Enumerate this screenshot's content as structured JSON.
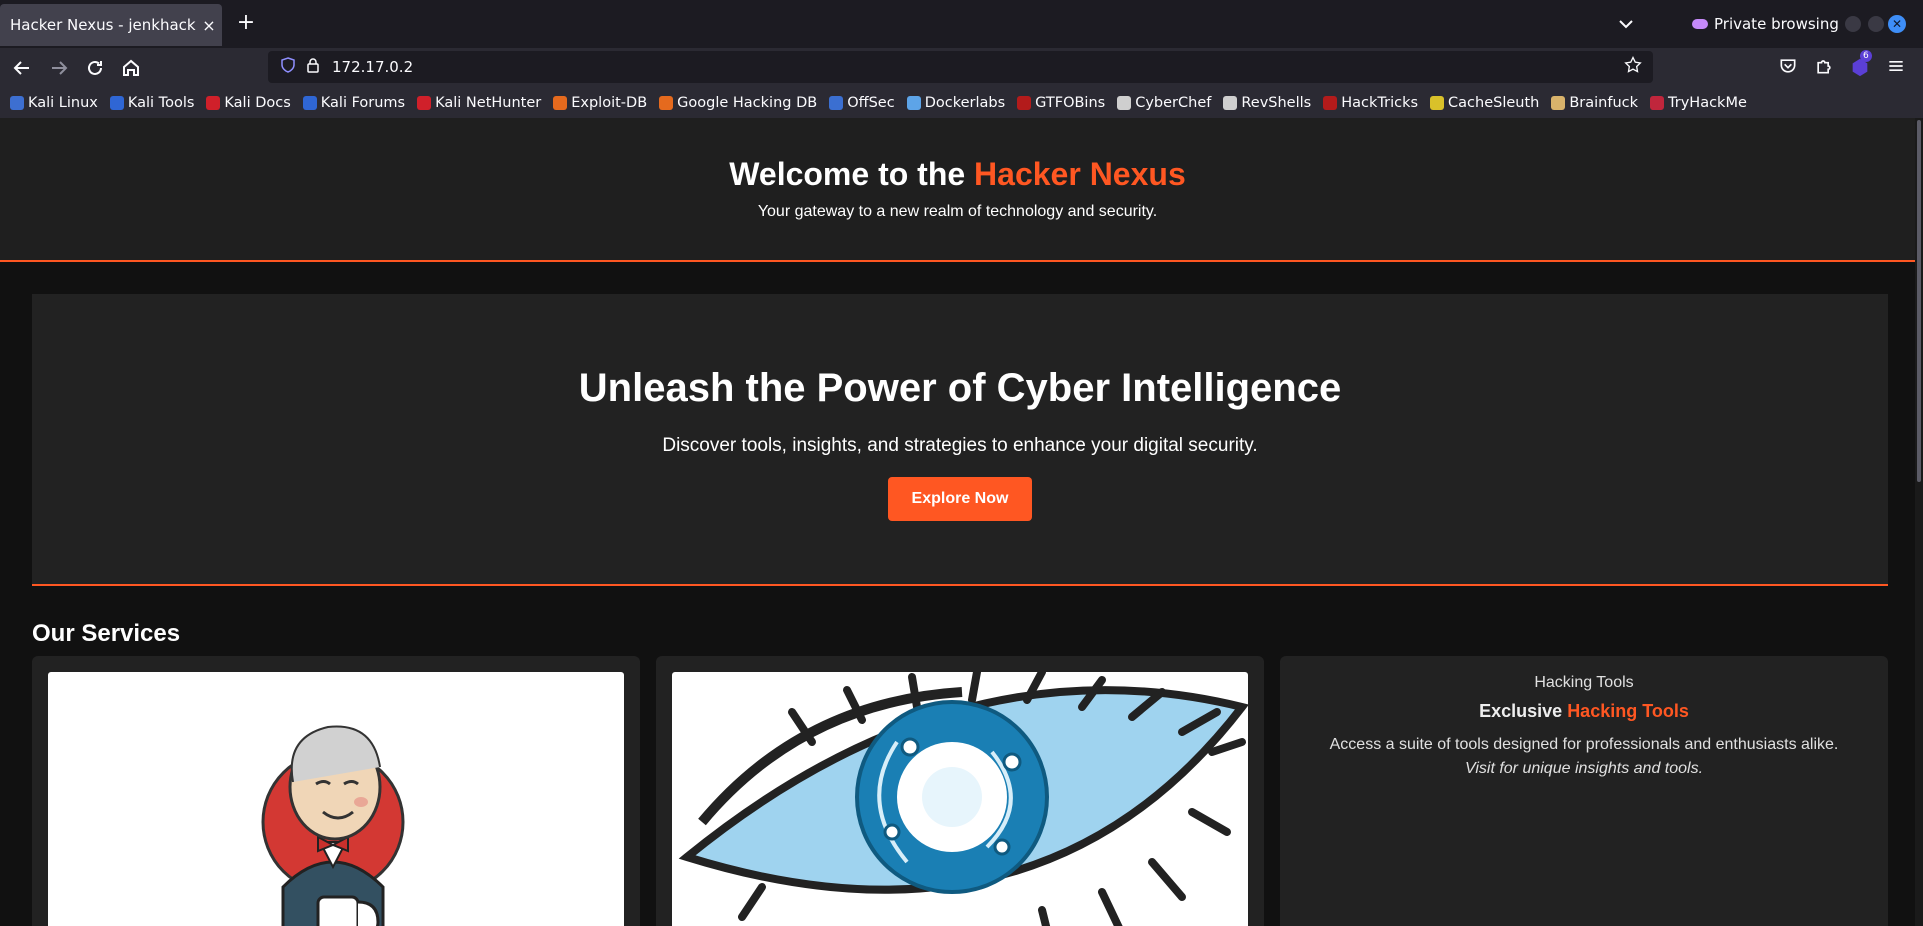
{
  "browser": {
    "tab_title": "Hacker Nexus - jenkhack.hl",
    "tab_close": "×",
    "new_tab": "+",
    "private_label": "Private browsing",
    "url": "172.17.0.2",
    "extensions_badge": "6"
  },
  "bookmarks": [
    {
      "label": "Kali Linux",
      "color": "#3d6fd1"
    },
    {
      "label": "Kali Tools",
      "color": "#2f66d4"
    },
    {
      "label": "Kali Docs",
      "color": "#d0202a"
    },
    {
      "label": "Kali Forums",
      "color": "#2f66d4"
    },
    {
      "label": "Kali NetHunter",
      "color": "#d0202a"
    },
    {
      "label": "Exploit-DB",
      "color": "#e56a1e"
    },
    {
      "label": "Google Hacking DB",
      "color": "#e56a1e"
    },
    {
      "label": "OffSec",
      "color": "#3b6fd1"
    },
    {
      "label": "Dockerlabs",
      "color": "#5da4e8"
    },
    {
      "label": "GTFOBins",
      "color": "#b31b1b"
    },
    {
      "label": "CyberChef",
      "color": "#cfcfcf"
    },
    {
      "label": "RevShells",
      "color": "#cfcfcf"
    },
    {
      "label": "HackTricks",
      "color": "#b31b1b"
    },
    {
      "label": "CacheSleuth",
      "color": "#d9c12a"
    },
    {
      "label": "Brainfuck",
      "color": "#d9b36b"
    },
    {
      "label": "TryHackMe",
      "color": "#c0263c"
    }
  ],
  "header": {
    "title_prefix": "Welcome to the ",
    "title_accent": "Hacker Nexus",
    "subtitle": "Your gateway to a new realm of technology and security."
  },
  "hero": {
    "title": "Unleash the Power of Cyber Intelligence",
    "text": "Discover tools, insights, and strategies to enhance your digital security.",
    "button": "Explore Now"
  },
  "services": {
    "title": "Our Services",
    "card3": {
      "small": "Hacking Tools",
      "big_prefix": "Exclusive ",
      "big_accent": "Hacking Tools",
      "desc": "Access a suite of tools designed for professionals and enthusiasts alike.",
      "note": "Visit for unique insights and tools."
    }
  },
  "colors": {
    "accent": "#ff5722",
    "background": "#111111",
    "panel": "#222222"
  }
}
